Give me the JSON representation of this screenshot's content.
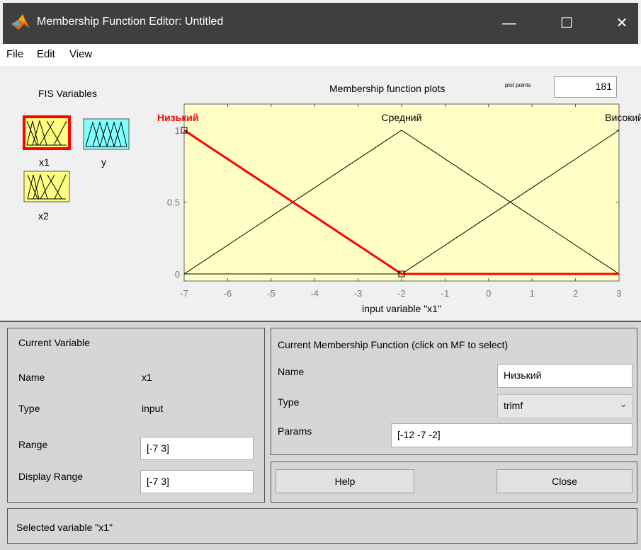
{
  "window": {
    "title": "Membership Function Editor: Untitled",
    "controls": {
      "minimize": "—",
      "maximize": "☐",
      "close": "✕"
    }
  },
  "menu": {
    "items": [
      "File",
      "Edit",
      "View"
    ]
  },
  "fis": {
    "label": "FIS Variables",
    "variables": [
      {
        "name": "x1",
        "kind": "input",
        "selected": true
      },
      {
        "name": "y",
        "kind": "output",
        "selected": false
      },
      {
        "name": "x2",
        "kind": "input",
        "selected": false
      }
    ]
  },
  "plots": {
    "title": "Membership function plots",
    "plot_points_label": "plot points",
    "plot_points_value": "181"
  },
  "chart_data": {
    "type": "line",
    "xlabel": "input variable \"x1\"",
    "xlim": [
      -7,
      3
    ],
    "ylim": [
      0,
      1
    ],
    "xticks": [
      "-7",
      "-6",
      "-5",
      "-4",
      "-3",
      "-2",
      "-1",
      "0",
      "1",
      "2",
      "3"
    ],
    "yticks": [
      "0",
      "0.5",
      "1"
    ],
    "background": "#ffffc6",
    "series": [
      {
        "name": "Низький",
        "x": [
          -7,
          -2,
          3
        ],
        "y": [
          1,
          0,
          0
        ],
        "color": "#ff0000",
        "selected": true
      },
      {
        "name": "Средний",
        "x": [
          -7,
          -2,
          3
        ],
        "y": [
          0,
          1,
          0
        ],
        "color": "#000000",
        "selected": false
      },
      {
        "name": "Високий",
        "x": [
          -7,
          -2,
          3
        ],
        "y": [
          0,
          0,
          1
        ],
        "color": "#000000",
        "selected": false
      }
    ]
  },
  "current_variable": {
    "title": "Current Variable",
    "name_label": "Name",
    "name_value": "x1",
    "type_label": "Type",
    "type_value": "input",
    "range_label": "Range",
    "range_value": "[-7 3]",
    "display_range_label": "Display Range",
    "display_range_value": "[-7 3]"
  },
  "current_mf": {
    "title": "Current Membership Function (click on MF to select)",
    "name_label": "Name",
    "name_value": "Низький",
    "type_label": "Type",
    "type_value": "trimf",
    "params_label": "Params",
    "params_value": "[-12 -7 -2]"
  },
  "buttons": {
    "help": "Help",
    "close": "Close"
  },
  "status": "Selected variable \"x1\"",
  "colors": {
    "input_fill": "#ffff80",
    "output_fill": "#80ffff",
    "selected_border": "#ff0000",
    "title_bar": "#3f3f3f"
  }
}
